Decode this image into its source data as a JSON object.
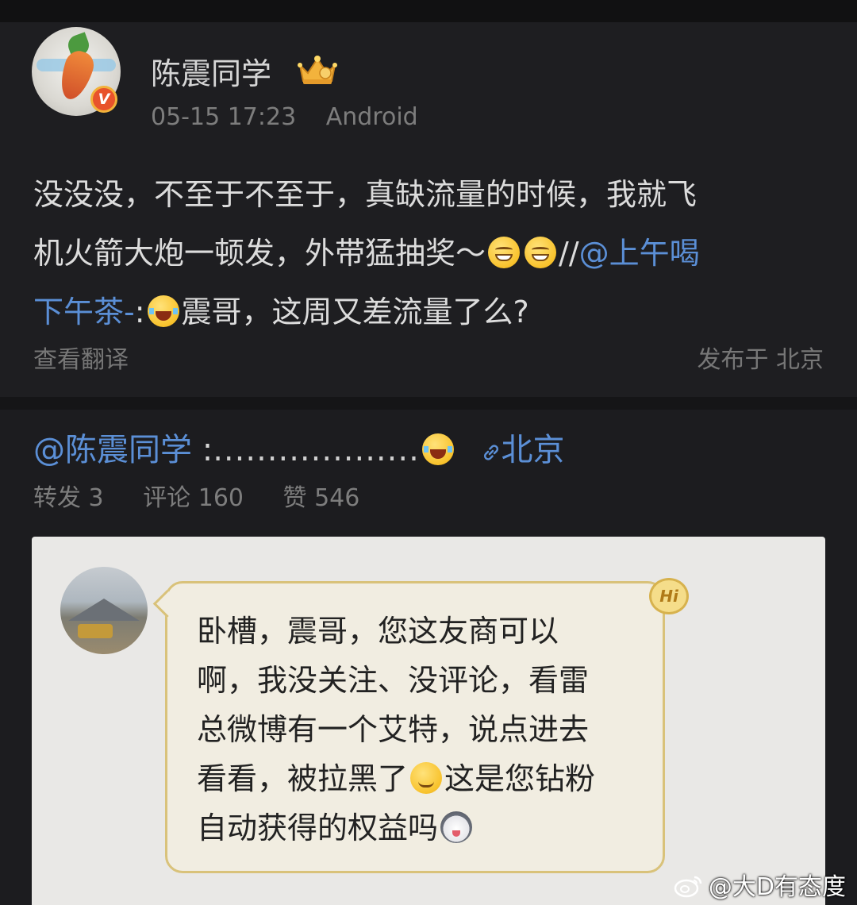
{
  "post": {
    "username": "陈震同学",
    "timestamp": "05-15 17:23",
    "source": "Android",
    "verified_badge": "V",
    "text": {
      "line1": "没没没，不至于不至于，真缺流量的时候，我就飞",
      "line2_a": "机火箭大炮一顿发，外带猛抽奖～",
      "line2_b": "//",
      "line2_mention": "@上午喝",
      "line3_mention": "下午茶-",
      "line3_colon": ":",
      "line3_b": "震哥，这周又差流量了么?"
    },
    "translate_label": "查看翻译",
    "location_label": "发布于 北京"
  },
  "repost": {
    "mention": "@陈震同学",
    "colon": " :",
    "dots": "...................",
    "location_link": "北京",
    "stats": {
      "repost_label": "转发",
      "repost_count": "3",
      "comment_label": "评论",
      "comment_count": "160",
      "like_label": "赞",
      "like_count": "546"
    }
  },
  "card": {
    "hi_badge": "Hi",
    "message": {
      "line1": "卧槽，震哥，您这友商可以",
      "line2": "啊，我没关注、没评论，看雷",
      "line3": "总微博有一个艾特，说点进去",
      "line4_a": "看看，被拉黑了",
      "line4_b": "这是您钻粉",
      "line5": "自动获得的权益吗"
    }
  },
  "watermark": "@大D有态度",
  "icons": {
    "crown": "vip-crown-icon",
    "verified": "verified-v-icon",
    "link": "link-chain-icon",
    "weibo": "weibo-logo-icon",
    "emojis": [
      "grin-emoji",
      "grin-emoji",
      "laugh-cry-emoji",
      "laugh-cry-emoji",
      "smirk-emoji",
      "husky-dog-emoji"
    ]
  },
  "colors": {
    "background": "#1e1e21",
    "link": "#5b8fd6",
    "text": "#dcdcdc",
    "muted": "#7d7d7d",
    "card": "#e9e8e6",
    "bubble": "#f1ede1"
  }
}
